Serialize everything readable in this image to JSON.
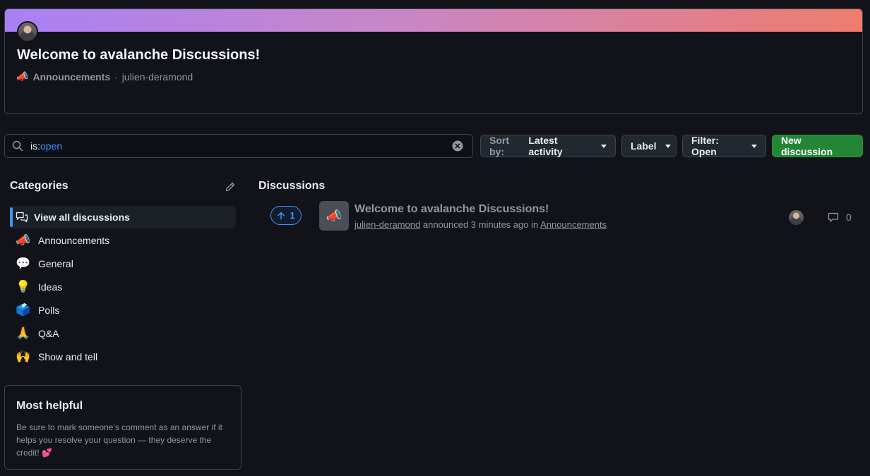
{
  "featured": {
    "title": "Welcome to avalanche Discussions!",
    "category_emoji": "📣",
    "category": "Announcements",
    "separator": "·",
    "author": "julien-deramond"
  },
  "search": {
    "prefix": "is:",
    "value": "open"
  },
  "toolbar": {
    "sort_prefix": "Sort by:",
    "sort_value": "Latest activity",
    "label": "Label",
    "filter": "Filter: Open",
    "new_discussion": "New discussion"
  },
  "sidebar": {
    "heading": "Categories",
    "items": [
      {
        "label": "View all discussions",
        "emoji": ""
      },
      {
        "label": "Announcements",
        "emoji": "📣"
      },
      {
        "label": "General",
        "emoji": "💬"
      },
      {
        "label": "Ideas",
        "emoji": "💡"
      },
      {
        "label": "Polls",
        "emoji": "🗳️"
      },
      {
        "label": "Q&A",
        "emoji": "🙏"
      },
      {
        "label": "Show and tell",
        "emoji": "🙌"
      }
    ],
    "helpful": {
      "title": "Most helpful",
      "text": "Be sure to mark someone’s comment as an answer if it helps you resolve your question — they deserve the credit! 💕"
    }
  },
  "discussions": {
    "heading": "Discussions",
    "rows": [
      {
        "upvotes": "1",
        "emoji": "📣",
        "title": "Welcome to avalanche Discussions!",
        "author": "julien-deramond",
        "action": "announced 3 minutes ago in",
        "category": "Announcements",
        "comments": "0"
      }
    ]
  }
}
